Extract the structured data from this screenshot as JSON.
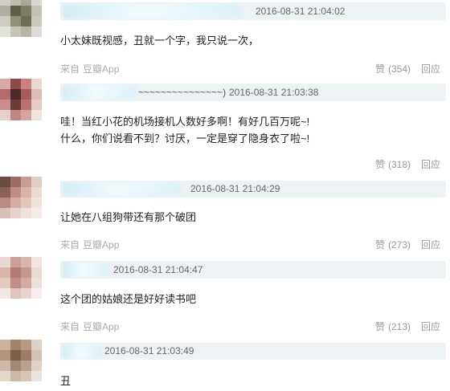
{
  "comments": [
    {
      "time": "2016-08-31 21:04:02",
      "text": [
        "小太妹既视感，丑就一个字，我只说一次，"
      ],
      "source": {
        "prefix": "来自",
        "app": "豆瓣App"
      },
      "like": {
        "label": "赞",
        "count": "(354)"
      },
      "reply_label": "回应"
    },
    {
      "author_visible": "~~~~~~~~~~~~~~~)",
      "time": "2016-08-31 21:03:38",
      "text": [
        "哇！当红小花的机场接机人数好多啊！有好几百万呢~!",
        "什么，你们说看不到？讨厌，一定是穿了隐身衣了啦~!"
      ],
      "like": {
        "label": "赞",
        "count": "(318)"
      },
      "reply_label": "回应"
    },
    {
      "time": "2016-08-31 21:04:29",
      "text": [
        "让她在八组狗带还有那个破团"
      ],
      "source": {
        "prefix": "来自",
        "app": "豆瓣App"
      },
      "like": {
        "label": "赞",
        "count": "(273)"
      },
      "reply_label": "回应"
    },
    {
      "time": "2016-08-31 21:04:47",
      "text": [
        "这个团的姑娘还是好好读书吧"
      ],
      "source": {
        "prefix": "来自",
        "app": "豆瓣App"
      },
      "like": {
        "label": "赞",
        "count": "(213)"
      },
      "reply_label": "回应"
    },
    {
      "time": "2016-08-31 21:03:49",
      "text": [
        "丑"
      ]
    }
  ]
}
